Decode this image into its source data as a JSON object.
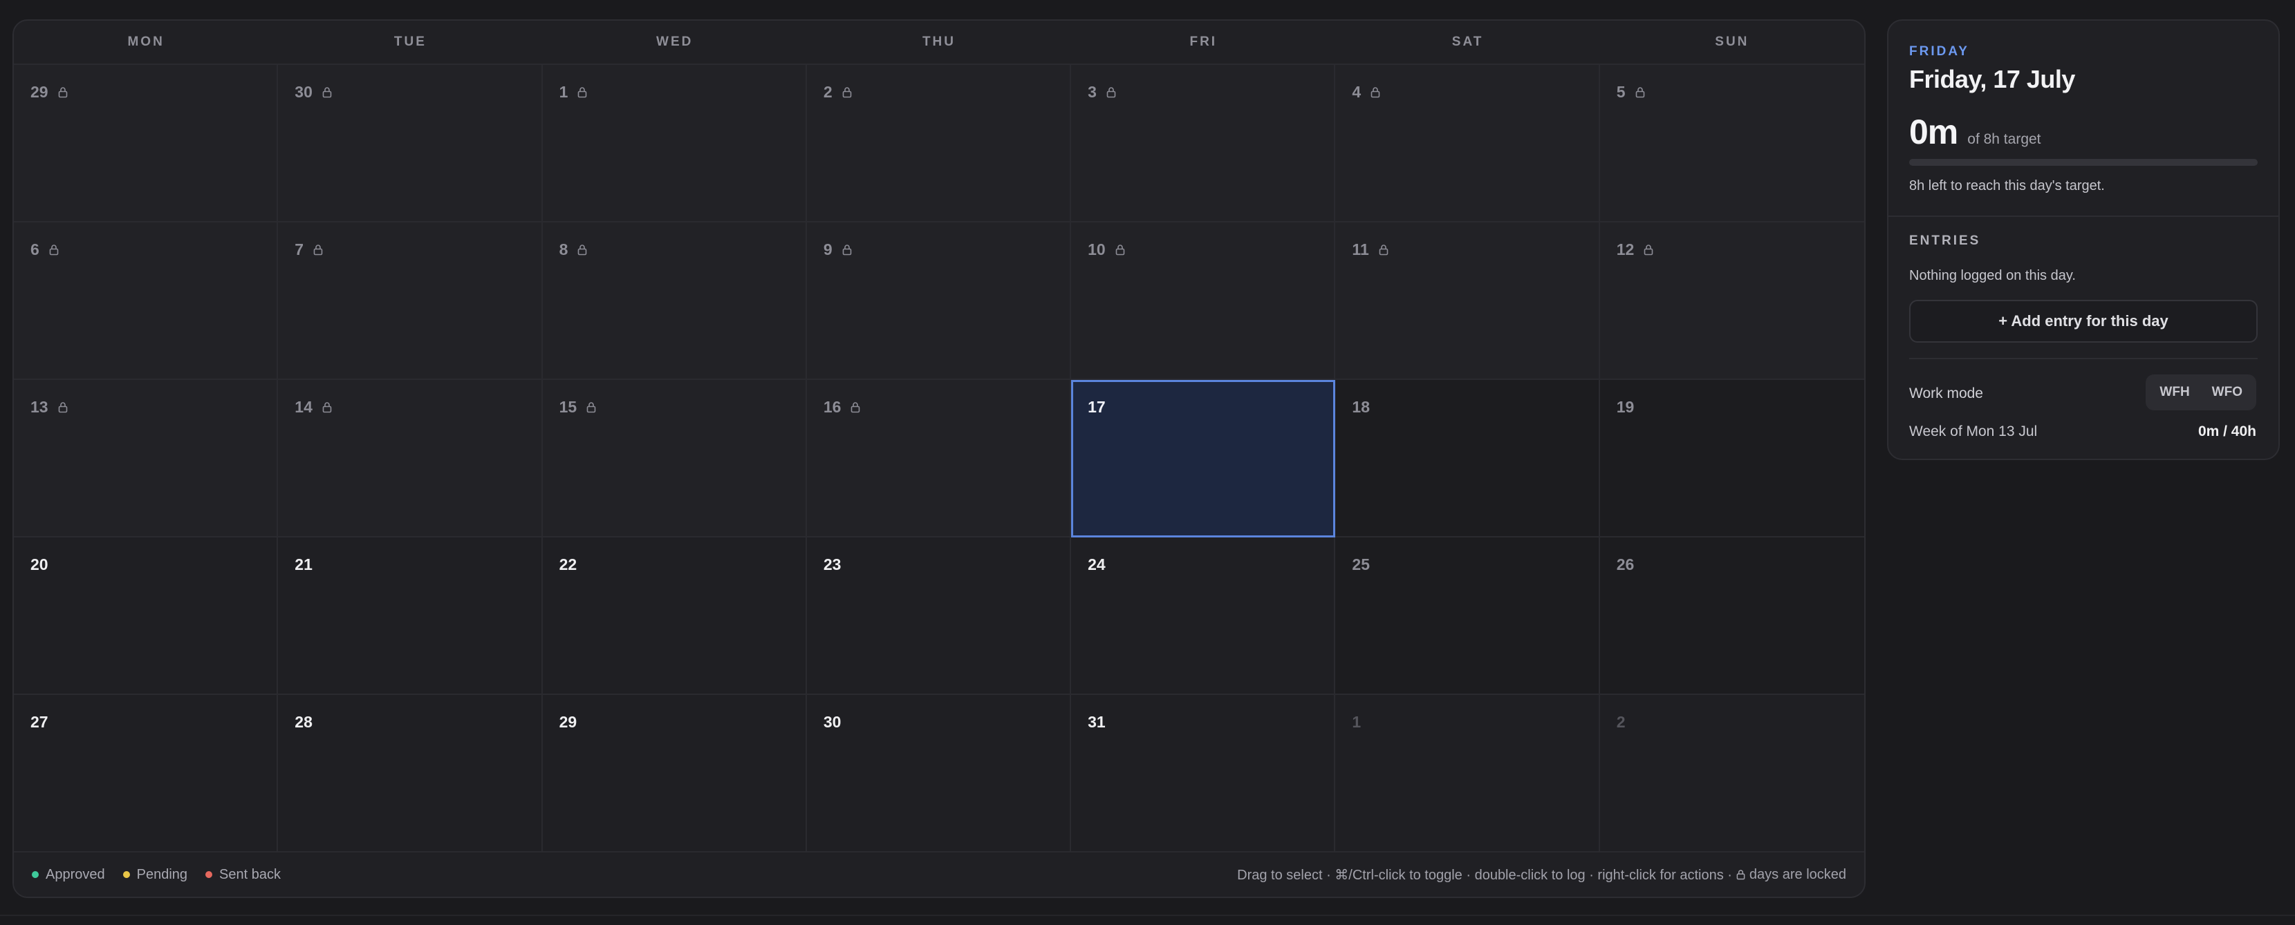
{
  "calendar": {
    "weekdays": [
      "MON",
      "TUE",
      "WED",
      "THU",
      "FRI",
      "SAT",
      "SUN"
    ],
    "days": [
      {
        "n": "29",
        "state": "locked"
      },
      {
        "n": "30",
        "state": "locked"
      },
      {
        "n": "1",
        "state": "locked"
      },
      {
        "n": "2",
        "state": "locked"
      },
      {
        "n": "3",
        "state": "locked"
      },
      {
        "n": "4",
        "state": "locked"
      },
      {
        "n": "5",
        "state": "locked"
      },
      {
        "n": "6",
        "state": "locked"
      },
      {
        "n": "7",
        "state": "locked"
      },
      {
        "n": "8",
        "state": "locked"
      },
      {
        "n": "9",
        "state": "locked"
      },
      {
        "n": "10",
        "state": "locked"
      },
      {
        "n": "11",
        "state": "locked"
      },
      {
        "n": "12",
        "state": "locked"
      },
      {
        "n": "13",
        "state": "locked"
      },
      {
        "n": "14",
        "state": "locked"
      },
      {
        "n": "15",
        "state": "locked"
      },
      {
        "n": "16",
        "state": "locked"
      },
      {
        "n": "17",
        "state": "selected"
      },
      {
        "n": "18",
        "state": "weekend"
      },
      {
        "n": "19",
        "state": "weekend"
      },
      {
        "n": "20",
        "state": "normal"
      },
      {
        "n": "21",
        "state": "normal"
      },
      {
        "n": "22",
        "state": "normal"
      },
      {
        "n": "23",
        "state": "normal"
      },
      {
        "n": "24",
        "state": "normal"
      },
      {
        "n": "25",
        "state": "weekend"
      },
      {
        "n": "26",
        "state": "weekend"
      },
      {
        "n": "27",
        "state": "normal"
      },
      {
        "n": "28",
        "state": "normal"
      },
      {
        "n": "29",
        "state": "normal"
      },
      {
        "n": "30",
        "state": "normal"
      },
      {
        "n": "31",
        "state": "normal"
      },
      {
        "n": "1",
        "state": "muted"
      },
      {
        "n": "2",
        "state": "muted"
      }
    ],
    "legend": [
      {
        "label": "Approved",
        "color": "#3ec99a"
      },
      {
        "label": "Pending",
        "color": "#e8c547"
      },
      {
        "label": "Sent back",
        "color": "#e5685e"
      }
    ],
    "hint": "Drag to select · ⌘/Ctrl-click to toggle · double-click to log · right-click for actions ·",
    "hint_tail": "days are locked"
  },
  "panel": {
    "day_label": "FRIDAY",
    "date_title": "Friday, 17 July",
    "hours_logged": "0m",
    "hours_target": "of 8h target",
    "progress_fraction": 0,
    "left_text": "8h left to reach this day's target.",
    "entries_label": "ENTRIES",
    "nothing_text": "Nothing logged on this day.",
    "add_button": "+ Add entry for this day",
    "work_mode_label": "Work mode",
    "work_mode_options": [
      "WFH",
      "WFO"
    ],
    "week_label": "Week of Mon 13 Jul",
    "week_value": "0m / 40h"
  },
  "colors": {
    "accent": "#6c99f0",
    "selected_border": "#5b85dd"
  }
}
